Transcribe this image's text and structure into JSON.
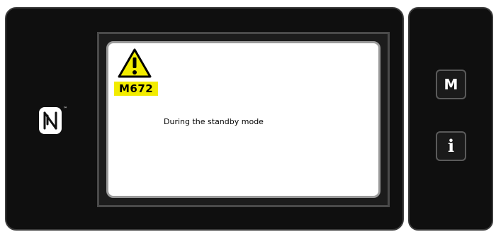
{
  "screen": {
    "error_code": "M672",
    "message": "During the standby mode",
    "warning_icon": "warning-triangle-icon",
    "error_code_color": "#f2ec00"
  },
  "panel": {
    "nfc_icon": "nfc-n-mark-icon",
    "nfc_trademark": "™",
    "m_button_label": "M",
    "info_button_label": "i"
  }
}
